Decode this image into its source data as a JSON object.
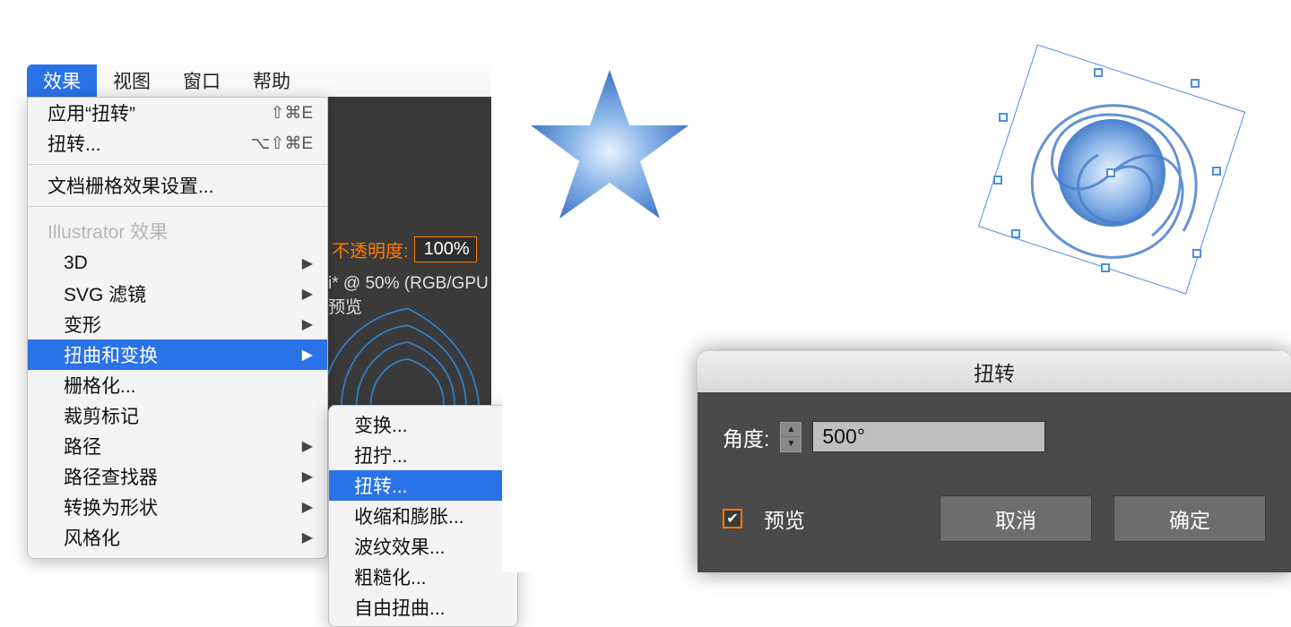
{
  "menubar": {
    "items": [
      "效果",
      "视图",
      "窗口",
      "帮助"
    ],
    "active_index": 0
  },
  "opacity": {
    "label": "不透明度:",
    "value": "100%"
  },
  "doc_status": "i* @ 50% (RGB/GPU 预览",
  "menu": {
    "apply_last": {
      "label": "应用“扭转”",
      "shortcut": "⇧⌘E"
    },
    "last_effect": {
      "label": "扭转...",
      "shortcut": "⌥⇧⌘E"
    },
    "doc_raster": "文档栅格效果设置...",
    "section_header": "Illustrator 效果",
    "items": [
      {
        "label": "3D",
        "has_sub": true
      },
      {
        "label": "SVG 滤镜",
        "has_sub": true
      },
      {
        "label": "变形",
        "has_sub": true
      },
      {
        "label": "扭曲和变换",
        "has_sub": true,
        "highlighted": true
      },
      {
        "label": "栅格化..."
      },
      {
        "label": "裁剪标记"
      },
      {
        "label": "路径",
        "has_sub": true
      },
      {
        "label": "路径查找器",
        "has_sub": true
      },
      {
        "label": "转换为形状",
        "has_sub": true
      },
      {
        "label": "风格化",
        "has_sub": true
      }
    ]
  },
  "submenu": {
    "items": [
      {
        "label": "变换..."
      },
      {
        "label": "扭拧..."
      },
      {
        "label": "扭转...",
        "highlighted": true
      },
      {
        "label": "收缩和膨胀..."
      },
      {
        "label": "波纹效果..."
      },
      {
        "label": "粗糙化..."
      },
      {
        "label": "自由扭曲..."
      }
    ]
  },
  "dialog": {
    "title": "扭转",
    "angle_label": "角度:",
    "angle_value": "500°",
    "preview_label": "预览",
    "preview_checked": true,
    "cancel": "取消",
    "ok": "确定"
  }
}
